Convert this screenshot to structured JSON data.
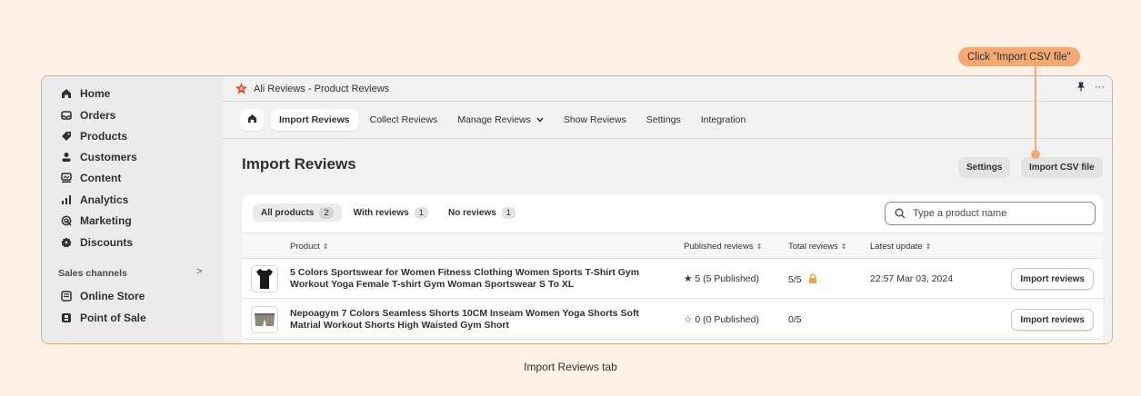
{
  "sidebar": {
    "items": [
      {
        "label": "Home",
        "icon": "home-icon"
      },
      {
        "label": "Orders",
        "icon": "inbox-icon"
      },
      {
        "label": "Products",
        "icon": "tag-icon"
      },
      {
        "label": "Customers",
        "icon": "person-icon"
      },
      {
        "label": "Content",
        "icon": "content-icon"
      },
      {
        "label": "Analytics",
        "icon": "bar-chart-icon"
      },
      {
        "label": "Marketing",
        "icon": "target-icon"
      },
      {
        "label": "Discounts",
        "icon": "discount-icon"
      }
    ],
    "sales_channels_label": "Sales channels",
    "sales_channels_chevron": ">",
    "channels": [
      {
        "label": "Online Store",
        "icon": "store-icon"
      },
      {
        "label": "Point of Sale",
        "icon": "pos-icon"
      }
    ]
  },
  "app": {
    "title": "Ali Reviews - Product Reviews",
    "pin_icon": "pin-icon",
    "more_icon": "···",
    "tabs": [
      {
        "label": "Import Reviews",
        "active": true
      },
      {
        "label": "Collect Reviews"
      },
      {
        "label": "Manage Reviews",
        "dropdown": true
      },
      {
        "label": "Show Reviews"
      },
      {
        "label": "Settings"
      },
      {
        "label": "Integration"
      }
    ],
    "page_title": "Import Reviews",
    "settings_button": "Settings",
    "import_csv_button": "Import CSV file",
    "filters": [
      {
        "label": "All products",
        "count": "2",
        "active": true
      },
      {
        "label": "With reviews",
        "count": "1"
      },
      {
        "label": "No reviews",
        "count": "1"
      }
    ],
    "search_placeholder": "Type a product name",
    "columns": {
      "product": "Product",
      "published": "Published reviews",
      "total": "Total reviews",
      "latest": "Latest update"
    },
    "rows": [
      {
        "name": "5 Colors Sportswear for Women Fitness Clothing Women Sports T-Shirt Gym Workout Yoga Female T-shirt Gym Woman Sportswear S To XL",
        "published": "★ 5  (5 Published)",
        "total": "5/5",
        "locked": true,
        "latest": "22:57 Mar 03, 2024",
        "action": "Import reviews"
      },
      {
        "name": "Nepoagym 7 Colors Seamless Shorts 10CM Inseam Women Yoga Shorts Soft Matrial Workout Shorts High Waisted Gym Short",
        "published": "☆ 0  (0 Published)",
        "total": "0/5",
        "locked": false,
        "latest": "",
        "action": "Import reviews"
      }
    ]
  },
  "callout": "Click \"Import CSV file\"",
  "caption": "Import Reviews tab",
  "colors": {
    "accent": "#f4a972",
    "background": "#fdf0e4",
    "logo": "#e8472b"
  }
}
